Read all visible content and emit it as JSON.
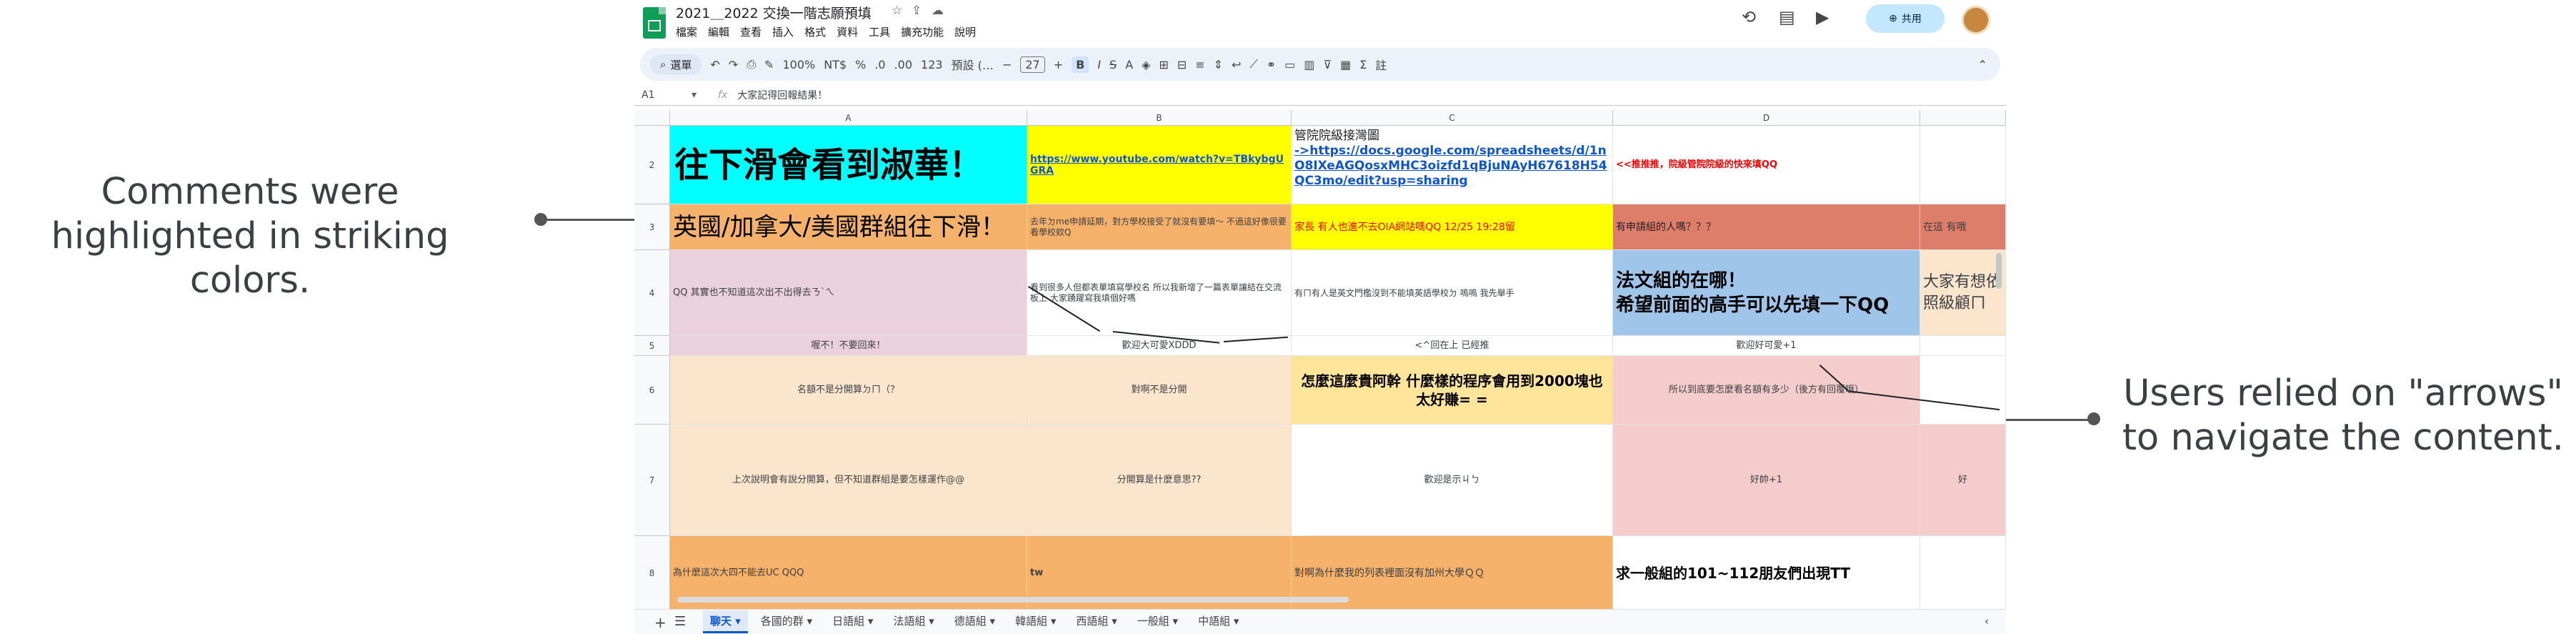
{
  "annotations": {
    "left": "Comments were highlighted in striking colors.",
    "right": "Users relied on \"arrows\" to navigate the content."
  },
  "doc": {
    "title": "2021＿2022 交換一階志願預填",
    "menu": [
      "檔案",
      "編輯",
      "查看",
      "插入",
      "格式",
      "資料",
      "工具",
      "擴充功能",
      "說明"
    ],
    "share": "共用"
  },
  "toolbar": {
    "search": "選單",
    "zoom": "100%",
    "currency": "NT$",
    "percent": "%",
    "dec_less": ".0",
    "dec_more": ".00",
    "num_format": "123",
    "font": "預設 (…",
    "font_size": "27",
    "bold": "B",
    "italic": "I",
    "strike": "S",
    "text_color": "A",
    "comment": "註"
  },
  "formula": {
    "cell_ref": "A1",
    "fx": "fx",
    "content": "大家記得回報結果！"
  },
  "columns": [
    "A",
    "B",
    "C",
    "D"
  ],
  "rows": [
    "2",
    "3",
    "4",
    "5",
    "6",
    "7",
    "8"
  ],
  "cells": {
    "a2": "往下滑會看到淑華！",
    "b2": "https://www.youtube.com/watch?v=TBkybgUGRA",
    "c2a": "管院院級接灣圖",
    "c2b": "->https://docs.google.com/spreadsheets/d/1nO8IXeAGQosxMHC3oizfd1qBjuNAyH67618H54QC3mo/edit?usp=sharing",
    "d2": "<<推推推，院級管院院級的快來填QQ",
    "a3": "英國/加拿大/美國群組往下滑！",
    "b3": "去年ㄉme申請延期，對方學校接受了就沒有要填～ 不過這好像很要看學校欸Q",
    "c3": "家長 有人也進不去OIA網站嗎QQ 12/25 19:28留",
    "d3": "有申請組的人嗎？？？",
    "e3": "在這 有哦",
    "a4": "QQ 其實也不知道這次出不出得去ㄋˋㄟ",
    "b4": "看到很多人但都表單填寫學校名 所以我新增了一篇表單讓結在交流板上 大家踴躍寫我填個好嗎",
    "c4": "有ㄇ有人是英文門檻沒到不能填英語學校ㄉ 嗚嗚 我先舉手",
    "d4": "法文組的在哪！\n希望前面的高手可以先填一下QQ",
    "e4": "大家有想依照級顧ㄇ",
    "a5": "喔不！不要回來！",
    "b5": "歡迎大可愛XDDD",
    "c5": "<^回在上 已經推",
    "d5": "歡迎好可愛+1",
    "a6": "名額不是分開算ㄉㄇ（？",
    "b6": "對啊不是分開",
    "c6": "怎麼這麼貴阿幹 什麼樣的程序會用到2000塊也太好賺= =",
    "d6": "所以到底要怎麼看名額有多少（後方有回覆哦）",
    "a7": "上次說明會有說分開算，但不知道群組是要怎樣運作@@",
    "b7": "分開算是什麼意思??",
    "c7": "歡迎是示ㄐㄅ",
    "d7": "好帥+1",
    "e7": "好",
    "a8": "為什麼這次大四不能去UC QQQ",
    "b8": "tw",
    "c8": "對啊為什麼我的列表裡面沒有加州大學ＱＱ",
    "d8": "求一般組的101~112朋友們出現TT"
  },
  "tabs": [
    "聊天",
    "各國的群",
    "日語組",
    "法語組",
    "德語組",
    "韓語組",
    "西語組",
    "一般組",
    "中語組"
  ],
  "colors": {
    "cyan": "#00ffff",
    "yellow": "#ffff00",
    "orange": "#f6b26b",
    "salmon": "#dd7e6b",
    "pink": "#ead1dc",
    "peach": "#fce5cd",
    "blue": "#9fc5e8",
    "gold": "#ffe599",
    "rose": "#f4cccc"
  }
}
